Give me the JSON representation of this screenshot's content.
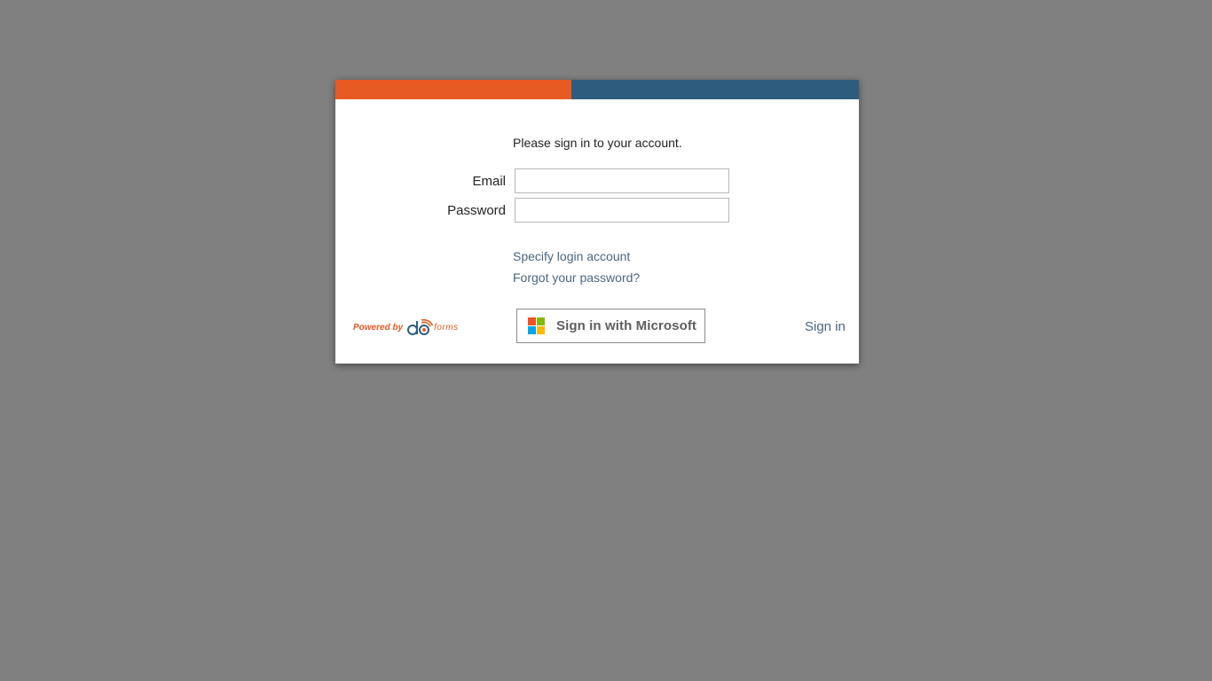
{
  "colors": {
    "background": "#808080",
    "accent_orange": "#e85a24",
    "accent_blue": "#2e5c7e",
    "link": "#4a6680"
  },
  "login": {
    "prompt": "Please sign in to your account.",
    "email_label": "Email",
    "email_value": "",
    "password_label": "Password",
    "password_value": "",
    "specify_account_link": "Specify login account",
    "forgot_password_link": "Forgot your password?",
    "microsoft_button": "Sign in with Microsoft",
    "signin_button": "Sign in"
  },
  "footer": {
    "powered_by": "Powered by",
    "brand_suffix": "forms",
    "logo_icon": "doforms-logo-icon"
  }
}
